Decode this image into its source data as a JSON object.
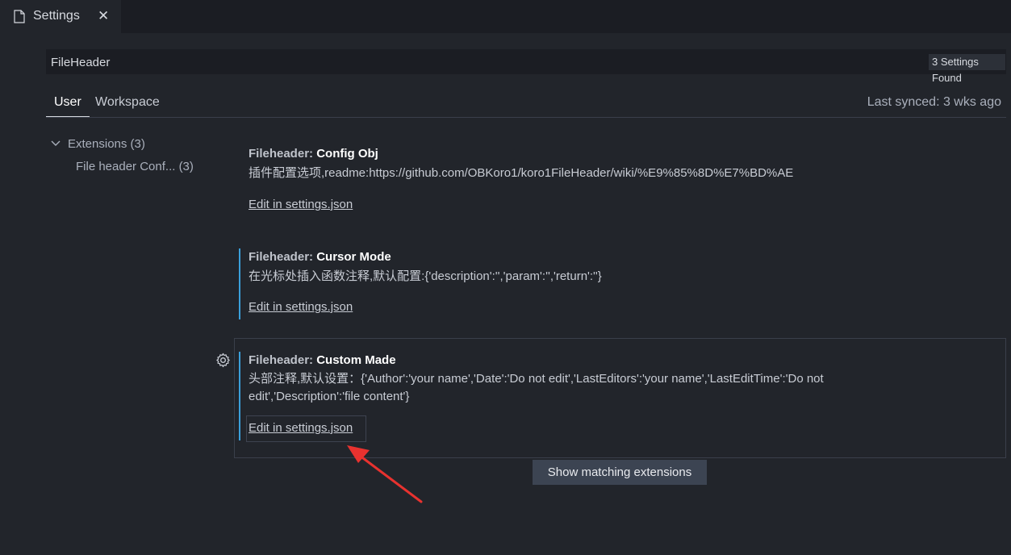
{
  "tab": {
    "title": "Settings",
    "close": "✕"
  },
  "search": {
    "value": "FileHeader",
    "found": "3 Settings Found"
  },
  "scope_tabs": {
    "user": "User",
    "workspace": "Workspace"
  },
  "last_synced": "Last synced: 3 wks ago",
  "toc": {
    "extensions": "Extensions (3)",
    "file_header": "File header Conf... (3)"
  },
  "settings": [
    {
      "category": "Fileheader: ",
      "name": "Config Obj",
      "description": "插件配置选项,readme:https://github.com/OBKoro1/koro1FileHeader/wiki/%E9%85%8D%E7%BD%AE",
      "link": "Edit in settings.json"
    },
    {
      "category": "Fileheader: ",
      "name": "Cursor Mode",
      "description": "在光标处插入函数注释,默认配置:{'description':'','param':'','return':''}",
      "link": "Edit in settings.json"
    },
    {
      "category": "Fileheader: ",
      "name": "Custom Made",
      "description": "头部注释,默认设置：{'Author':'your name','Date':'Do not edit','LastEditors':'your name','LastEditTime':'Do not edit','Description':'file content'}",
      "link": "Edit in settings.json"
    }
  ],
  "show_extensions": "Show matching extensions",
  "colors": {
    "accent": "#3a9fd9",
    "annotation_arrow": "#e8322f"
  },
  "icons": [
    "file-icon",
    "close-icon",
    "clear-filter-icon",
    "chevron-down-icon",
    "gear-icon",
    "red-arrow-annotation"
  ]
}
